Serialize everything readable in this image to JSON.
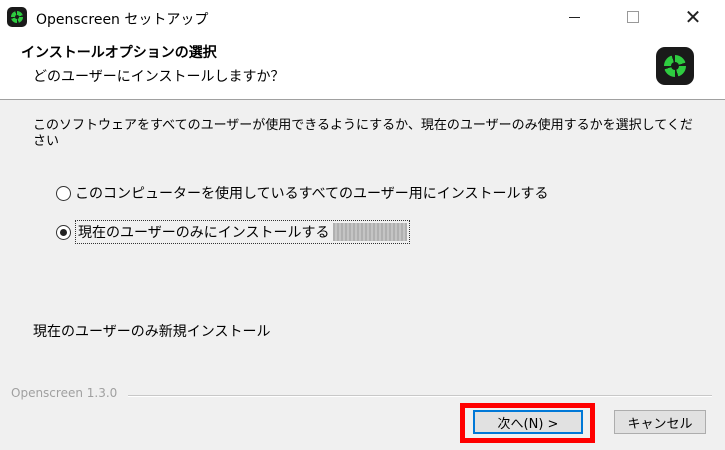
{
  "window": {
    "title": "Openscreen セットアップ",
    "controls": {
      "minimize_icon": "minimize-icon",
      "maximize_icon": "maximize-icon",
      "close_icon": "close-icon"
    }
  },
  "header": {
    "title": "インストールオプションの選択",
    "subtitle": "どのユーザーにインストールしますか？",
    "app_icon": "openscreen-logo-icon"
  },
  "body": {
    "description": "このソフトウェアをすべてのユーザーが使用できるようにするか、現在のユーザーのみ使用するかを選択してください",
    "options": [
      {
        "label": "このコンピューターを使用しているすべてのユーザー用にインストールする",
        "selected": false
      },
      {
        "label": "現在のユーザーのみにインストールする",
        "selected": true,
        "suffix_redacted": true
      }
    ],
    "info": "現在のユーザーのみ新規インストール"
  },
  "footer": {
    "version_label": "Openscreen 1.3.0",
    "next_button": "次へ(N) >",
    "cancel_button": "キャンセル"
  },
  "colors": {
    "focus_border": "#0078d7",
    "annotation_highlight": "#ff0000",
    "logo_green": "#2ecc40"
  }
}
